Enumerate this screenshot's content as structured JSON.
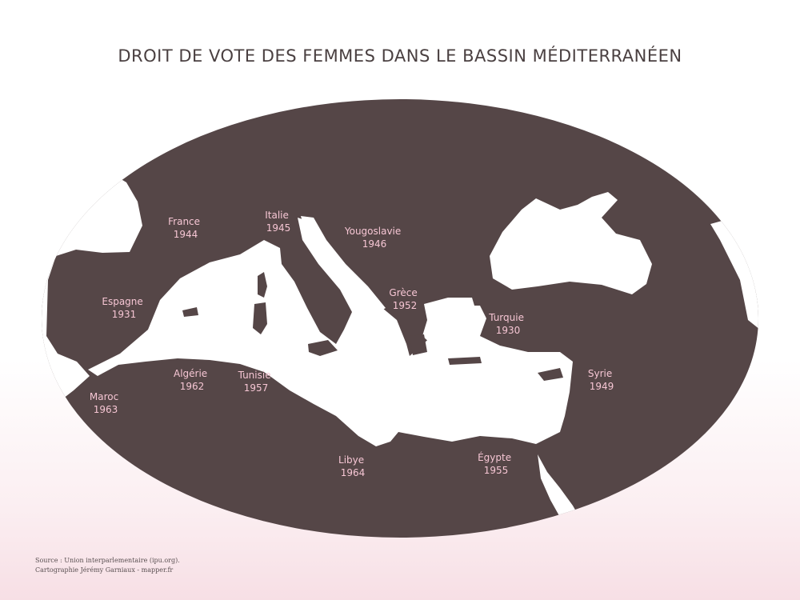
{
  "title": "DROIT DE VOTE DES FEMMES DANS LE BASSIN MÉDITERRANÉEN",
  "colors": {
    "land": "#554647",
    "sea": "#ffffff",
    "label": "#f6c6d4",
    "title": "#4a4041"
  },
  "countries": [
    {
      "name": "France",
      "year": "1944"
    },
    {
      "name": "Italie",
      "year": "1945"
    },
    {
      "name": "Yougoslavie",
      "year": "1946"
    },
    {
      "name": "Espagne",
      "year": "1931"
    },
    {
      "name": "Grèce",
      "year": "1952"
    },
    {
      "name": "Turquie",
      "year": "1930"
    },
    {
      "name": "Algérie",
      "year": "1962"
    },
    {
      "name": "Tunisie",
      "year": "1957"
    },
    {
      "name": "Syrie",
      "year": "1949"
    },
    {
      "name": "Maroc",
      "year": "1963"
    },
    {
      "name": "Libye",
      "year": "1964"
    },
    {
      "name": "Égypte",
      "year": "1955"
    }
  ],
  "source": {
    "line1": "Source : Union interparlementaire (ipu.org).",
    "line2": "Cartographie Jérémy Garniaux - mapper.fr"
  }
}
